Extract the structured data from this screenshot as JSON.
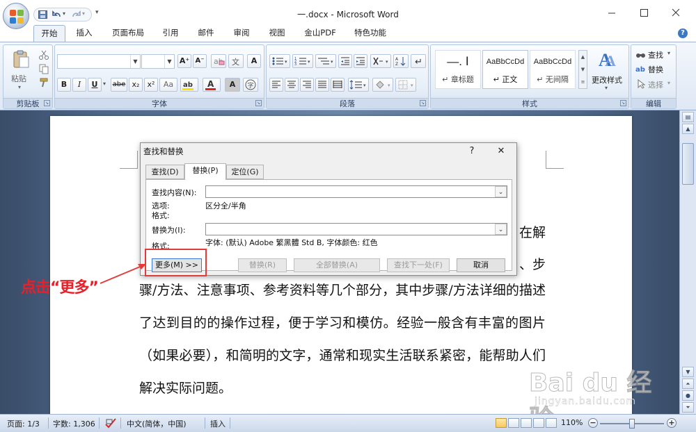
{
  "window": {
    "title": "一.docx - Microsoft Word",
    "controls": {
      "minimize": "—",
      "maximize": "☐",
      "close": "✕"
    }
  },
  "tabs": [
    "开始",
    "插入",
    "页面布局",
    "引用",
    "邮件",
    "审阅",
    "视图",
    "金山PDF",
    "特色功能"
  ],
  "ribbon": {
    "clipboard": {
      "label": "剪贴板",
      "paste": "粘贴"
    },
    "font": {
      "label": "字体",
      "bold": "B",
      "italic": "I",
      "underline": "U",
      "strike": "abe",
      "sub": "x₂",
      "sup": "x²",
      "change_case": "Aa",
      "grow": "A⁺",
      "shrink": "A⁻",
      "font_color": "A",
      "char_shade": "A",
      "enclose": "字",
      "clear": "A"
    },
    "paragraph": {
      "label": "段落"
    },
    "styles": {
      "label": "样式",
      "items": [
        {
          "sample": "—. Ⅰ",
          "name": "↵ 章标题"
        },
        {
          "sample": "AaBbCcDd",
          "name": "↵ 正文"
        },
        {
          "sample": "AaBbCcDd",
          "name": "↵ 无间隔"
        }
      ],
      "change": "更改样式"
    },
    "editing": {
      "label": "编辑",
      "find": "查找",
      "replace": "替换",
      "select": "选择"
    }
  },
  "document": {
    "fragments": {
      "line1_end": "在解",
      "line2_end": "、步"
    },
    "body": "骤/方法、注意事项、参考资料等几个部分，其中步骤/方法详细的描述了达到目的的操作过程，便于学习和模仿。经验一般含有丰富的图片（如果必要），和简明的文字，通常和现实生活联系紧密，能帮助人们解决实际问题。"
  },
  "dialog": {
    "title": "查找和替换",
    "help": "?",
    "close": "✕",
    "tabs": [
      "查找(D)",
      "替换(P)",
      "定位(G)"
    ],
    "find_label": "查找内容(N):",
    "options_label": "选项:",
    "options_value": "区分全/半角",
    "format_label": "格式:",
    "replace_label": "替换为(I):",
    "replace_format_label": "格式:",
    "replace_format_value": "字体: (默认) Adobe 繁黑體 Std B, 字体颜色: 红色",
    "buttons": {
      "more": "更多(M) >>",
      "replace": "替换(R)",
      "replace_all": "全部替换(A)",
      "find_next": "查找下一处(F)",
      "cancel": "取消"
    }
  },
  "annotation": {
    "callout": "点击“更多”",
    "highlight_color": "#e43a3a"
  },
  "statusbar": {
    "page": "页面: 1/3",
    "words": "字数: 1,306",
    "language": "中文(简体，中国)",
    "mode": "插入",
    "zoom": "110%",
    "zoom_minus": "−",
    "zoom_plus": "+"
  },
  "watermark": {
    "main": "Bai du 经验",
    "sub": "jingyan.baidu.com"
  }
}
